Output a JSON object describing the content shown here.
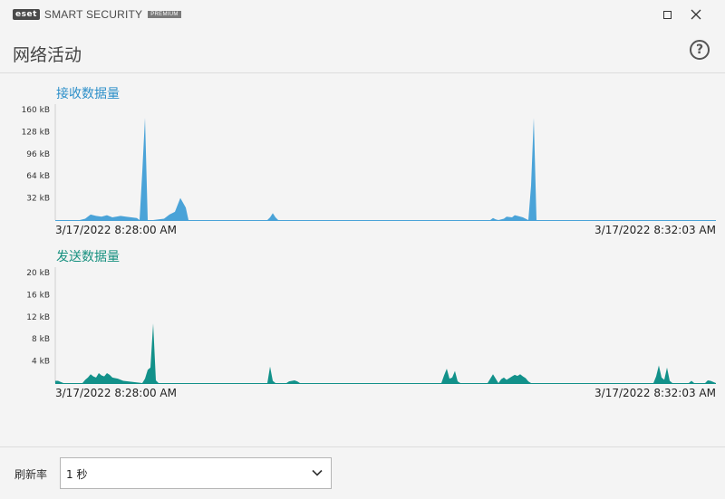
{
  "app": {
    "logo_text": "eset",
    "product_name": "SMART SECURITY",
    "edition": "PREMIUM"
  },
  "window_controls": {
    "icons": [
      "maximize-icon",
      "close-icon"
    ]
  },
  "page": {
    "title": "网络活动",
    "help_label": "?"
  },
  "chart_data": [
    {
      "type": "area",
      "title": "接收数据量",
      "color": "#4aa3d8",
      "y_ticks": [
        "160 kB",
        "128 kB",
        "96 kB",
        "64 kB",
        "32 kB"
      ],
      "y_tick_values": [
        160,
        128,
        96,
        64,
        32
      ],
      "ylim": [
        0,
        160
      ],
      "unit": "kB",
      "x_start_label": "3/17/2022 8:28:00 AM",
      "x_end_label": "3/17/2022 8:32:03 AM",
      "xlim": [
        0,
        243
      ],
      "series": [
        {
          "x": [
            0,
            9,
            11,
            13,
            15,
            17,
            19,
            21,
            24,
            26,
            28,
            30,
            31,
            32,
            33,
            34,
            35,
            36,
            40,
            42,
            44,
            46,
            48,
            49,
            50,
            53,
            78,
            79,
            80,
            81,
            82,
            84,
            160,
            161,
            162,
            163,
            165,
            166,
            168,
            169,
            170,
            172,
            173,
            174,
            175,
            176,
            177,
            179,
            181,
            243
          ],
          "y": [
            0,
            0,
            2,
            8,
            6,
            5,
            7,
            4,
            6,
            5,
            4,
            3,
            0,
            70,
            148,
            0,
            0,
            0,
            2,
            8,
            12,
            32,
            18,
            0,
            0,
            0,
            0,
            4,
            10,
            4,
            0,
            0,
            0,
            3,
            1,
            0,
            2,
            5,
            4,
            7,
            6,
            4,
            2,
            0,
            50,
            148,
            0,
            0,
            0,
            0
          ]
        }
      ]
    },
    {
      "type": "area",
      "title": "发送数据量",
      "color": "#12918a",
      "y_ticks": [
        "20 kB",
        "16 kB",
        "12 kB",
        "8 kB",
        "4 kB"
      ],
      "y_tick_values": [
        20,
        16,
        12,
        8,
        4
      ],
      "ylim": [
        0,
        20
      ],
      "unit": "kB",
      "x_start_label": "3/17/2022 8:28:00 AM",
      "x_end_label": "3/17/2022 8:32:03 AM",
      "xlim": [
        0,
        243
      ],
      "series": [
        {
          "x": [
            0,
            1,
            2,
            3,
            10,
            11,
            12,
            13,
            14,
            15,
            16,
            17,
            18,
            19,
            20,
            21,
            23,
            25,
            32,
            33,
            34,
            35,
            36,
            37,
            38,
            78,
            79,
            80,
            81,
            85,
            86,
            88,
            89,
            90,
            142,
            143,
            144,
            145,
            146,
            147,
            148,
            149,
            150,
            159,
            160,
            161,
            162,
            163,
            164,
            165,
            166,
            167,
            168,
            169,
            170,
            171,
            172,
            173,
            174,
            175,
            220,
            221,
            222,
            223,
            224,
            225,
            226,
            227,
            233,
            234,
            235,
            239,
            240,
            241,
            243
          ],
          "y": [
            0.4,
            0.4,
            0.2,
            0,
            0,
            0.6,
            1.0,
            1.6,
            1.2,
            1.0,
            1.8,
            1.4,
            1.2,
            1.8,
            1.5,
            1.0,
            0.8,
            0.4,
            0,
            0.8,
            2.4,
            2.8,
            10.8,
            0.5,
            0,
            0,
            3.0,
            0.4,
            0,
            0,
            0.3,
            0.5,
            0.3,
            0,
            0,
            1.4,
            2.6,
            0.8,
            1.0,
            2.2,
            0.3,
            0,
            0,
            0,
            0.8,
            1.6,
            0.8,
            0,
            0.7,
            1.0,
            0.6,
            0.9,
            1.2,
            1.5,
            1.3,
            1.6,
            1.2,
            0.9,
            0.3,
            0,
            0,
            1.2,
            3.2,
            1.0,
            0.6,
            2.8,
            0.4,
            0,
            0,
            0.4,
            0,
            0,
            0.5,
            0.4,
            0
          ]
        }
      ]
    }
  ],
  "footer": {
    "refresh_label": "刷新率",
    "refresh_value": "1 秒"
  }
}
